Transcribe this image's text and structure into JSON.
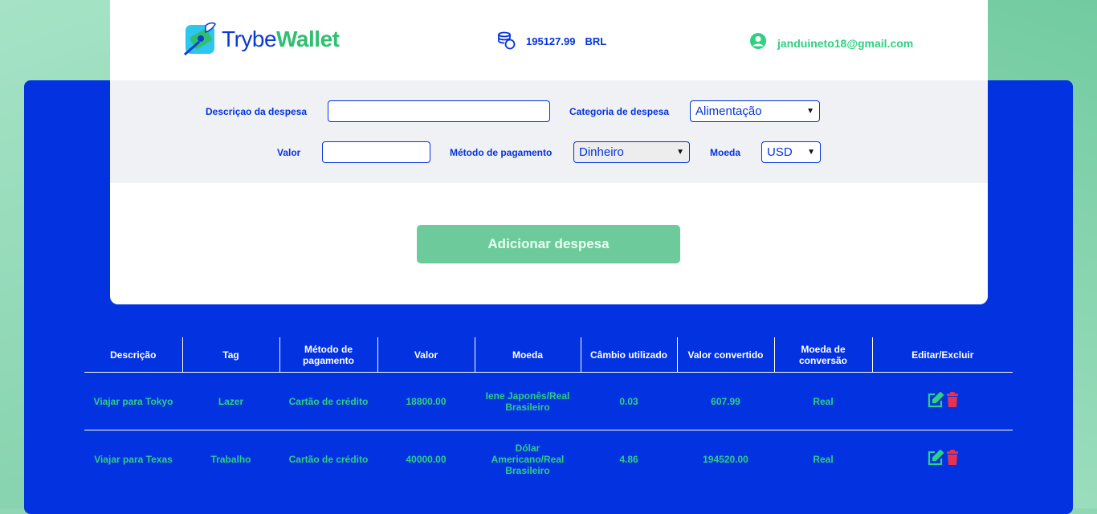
{
  "app": {
    "logo_light": "Trybe",
    "logo_bold": "Wallet"
  },
  "header": {
    "total": "195127.99",
    "currency": "BRL",
    "email": "janduineto18@gmail.com"
  },
  "form": {
    "description_label": "Descriçao da despesa",
    "description_value": "",
    "category_label": "Categoria de despesa",
    "category_value": "Alimentação",
    "value_label": "Valor",
    "value_value": "",
    "method_label": "Método de pagamento",
    "method_value": "Dinheiro",
    "currency_label": "Moeda",
    "currency_value": "USD",
    "add_button": "Adicionar despesa"
  },
  "table": {
    "headers": [
      "Descrição",
      "Tag",
      "Método de pagamento",
      "Valor",
      "Moeda",
      "Câmbio utilizado",
      "Valor convertido",
      "Moeda de conversão",
      "Editar/Excluir"
    ],
    "rows": [
      [
        "Viajar para Tokyo",
        "Lazer",
        "Cartão de crédito",
        "18800.00",
        "Iene Japonês/Real Brasileiro",
        "0.03",
        "607.99",
        "Real"
      ],
      [
        "Viajar para Texas",
        "Trabalho",
        "Cartão de crédito",
        "40000.00",
        "Dólar Americano/Real Brasileiro",
        "4.86",
        "194520.00",
        "Real"
      ]
    ]
  },
  "colors": {
    "blue": "#0333e0",
    "green": "#2fd082",
    "button": "#6dcb9b",
    "delete": "#e8304f"
  },
  "icons": {
    "logo": "wallet-logo-icon",
    "coins": "coins-icon",
    "user": "user-circle-icon",
    "edit": "edit-icon",
    "delete": "trash-icon"
  }
}
